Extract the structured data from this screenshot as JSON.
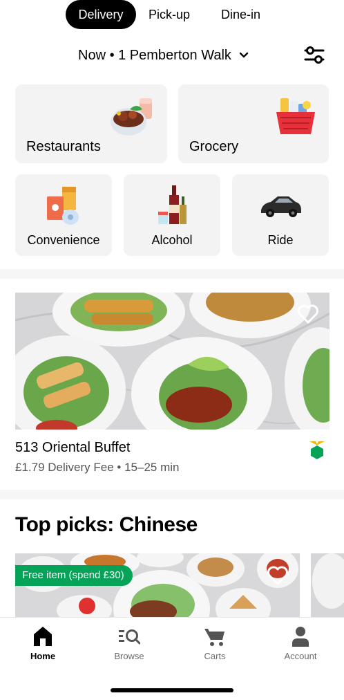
{
  "modes": [
    {
      "label": "Delivery",
      "active": true
    },
    {
      "label": "Pick-up",
      "active": false
    },
    {
      "label": "Dine-in",
      "active": false
    }
  ],
  "location": {
    "text": "Now • 1 Pemberton Walk",
    "icon": "chevron-down-icon"
  },
  "filter_icon": "filter-sliders-icon",
  "categories": [
    {
      "label": "Restaurants",
      "icon": "food-bowl-icon"
    },
    {
      "label": "Grocery",
      "icon": "grocery-basket-icon"
    },
    {
      "label": "Convenience",
      "icon": "convenience-goods-icon"
    },
    {
      "label": "Alcohol",
      "icon": "alcohol-bottles-icon"
    },
    {
      "label": "Ride",
      "icon": "car-icon"
    }
  ],
  "featured_store": {
    "name": "513 Oriental Buffet",
    "meta": "£1.79 Delivery Fee • 15–25 min",
    "favorite_icon": "heart-outline-icon",
    "badge_icon": "top-eats-badge-icon"
  },
  "top_picks": {
    "title": "Top picks: Chinese",
    "promo": "Free item (spend £30)",
    "favorite_icon": "heart-outline-icon"
  },
  "bottom_nav": [
    {
      "label": "Home",
      "icon": "home-icon",
      "active": true
    },
    {
      "label": "Browse",
      "icon": "browse-search-icon",
      "active": false
    },
    {
      "label": "Carts",
      "icon": "cart-icon",
      "active": false
    },
    {
      "label": "Account",
      "icon": "person-icon",
      "active": false
    }
  ],
  "colors": {
    "accent": "#000000",
    "promo_green": "#05a357",
    "tile_bg": "#f3f3f4",
    "muted_text": "#545454"
  }
}
